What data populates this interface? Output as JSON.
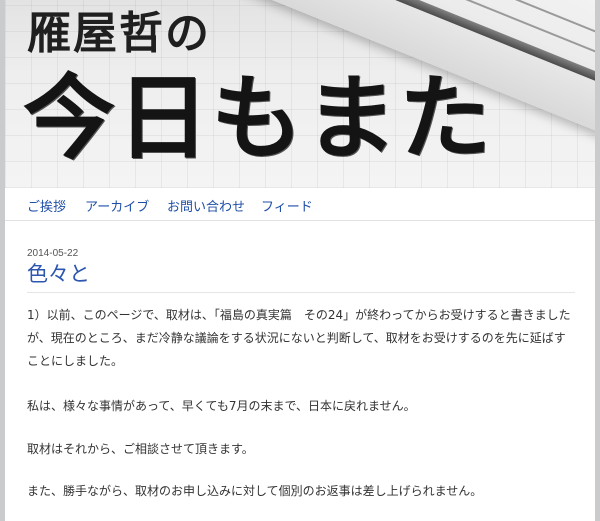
{
  "header": {
    "title_line1": "雁屋哲の",
    "title_line2": "今日もまた"
  },
  "nav": {
    "items": [
      {
        "label": "ご挨拶"
      },
      {
        "label": "アーカイブ"
      },
      {
        "label": "お問い合わせ"
      },
      {
        "label": "フィード"
      }
    ]
  },
  "post": {
    "date": "2014-05-22",
    "title": "色々と",
    "paragraphs": [
      "1）以前、このページで、取材は、「福島の真実篇　その24」が終わってからお受けすると書きましたが、現在のところ、まだ冷静な議論をする状況にないと判断して、取材をお受けするのを先に延ばすことにしました。",
      "私は、様々な事情があって、早くても7月の末まで、日本に戻れません。",
      "取材はそれから、ご相談させて頂きます。",
      "また、勝手ながら、取材のお申し込みに対して個別のお返事は差し上げられません。"
    ]
  },
  "colors": {
    "link": "#1f4fa6",
    "post_title": "#2c56b0",
    "frame": "#c9cbcd"
  }
}
